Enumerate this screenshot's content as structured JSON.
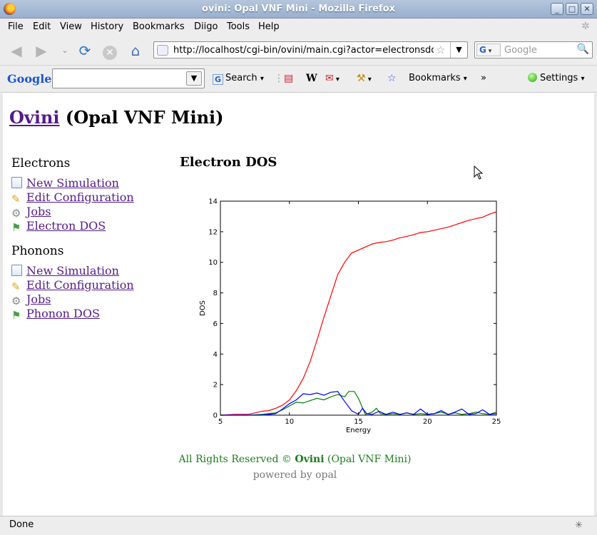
{
  "window": {
    "title": "ovini: Opal VNF Mini - Mozilla Firefox",
    "controls": [
      "_",
      "□",
      "✕"
    ]
  },
  "menu": [
    "File",
    "Edit",
    "View",
    "History",
    "Bookmarks",
    "Diigo",
    "Tools",
    "Help"
  ],
  "nav": {
    "url": "http://localhost/cgi-bin/ovini/main.cgi?actor=electronsdo",
    "search_engine_letter": "G",
    "search_placeholder": "Google"
  },
  "google_toolbar": {
    "logo": "Google",
    "search_label": "Search",
    "bookmarks_label": "Bookmarks",
    "more_label": "»",
    "settings_label": "Settings",
    "wiki_glyph": "W"
  },
  "page": {
    "brand_link": "Ovini",
    "brand_rest": " (Opal VNF Mini)",
    "sections": [
      {
        "heading": "Electrons",
        "links": [
          "New Simulation",
          "Edit Configuration",
          "Jobs",
          "Electron DOS"
        ]
      },
      {
        "heading": "Phonons",
        "links": [
          "New Simulation",
          "Edit Configuration",
          "Jobs",
          "Phonon DOS"
        ]
      }
    ],
    "main_heading": "Electron DOS",
    "footer_prefix": "All Rights Reserved © ",
    "footer_brand": "Ovini",
    "footer_suffix": " (Opal VNF Mini)",
    "powered_by": "powered by opal"
  },
  "status": {
    "text": "Done"
  },
  "colors": {
    "link": "#551a8b",
    "footer": "#1d7f1d",
    "series_red": "#ff0000",
    "series_green": "#008000",
    "series_blue": "#0000ff"
  },
  "chart_data": {
    "type": "line",
    "title": "",
    "xlabel": "Energy",
    "ylabel": "DOS",
    "xlim": [
      5,
      25
    ],
    "ylim": [
      0,
      14
    ],
    "xticks": [
      5,
      10,
      15,
      20,
      25
    ],
    "yticks": [
      0,
      2,
      4,
      6,
      8,
      10,
      12,
      14
    ],
    "grid": false,
    "legend": "none",
    "series": [
      {
        "color": "#ff0000",
        "x": [
          5,
          6,
          7,
          7.5,
          8,
          8.5,
          9,
          9.5,
          10,
          10.5,
          11,
          11.5,
          12,
          12.5,
          13,
          13.5,
          14,
          14.5,
          15,
          15.5,
          16,
          16.5,
          17,
          17.5,
          18,
          18.5,
          19,
          19.5,
          20,
          20.5,
          21,
          21.5,
          22,
          22.5,
          23,
          23.5,
          24,
          24.5,
          25
        ],
        "y": [
          0.0,
          0.05,
          0.05,
          0.15,
          0.25,
          0.3,
          0.45,
          0.65,
          1.0,
          1.6,
          2.4,
          3.5,
          4.9,
          6.4,
          7.8,
          9.2,
          10.0,
          10.6,
          10.8,
          11.0,
          11.2,
          11.3,
          11.35,
          11.45,
          11.6,
          11.7,
          11.8,
          11.95,
          12.0,
          12.1,
          12.2,
          12.3,
          12.45,
          12.6,
          12.75,
          12.85,
          12.95,
          13.15,
          13.3
        ]
      },
      {
        "color": "#008000",
        "x": [
          5,
          7,
          8,
          9,
          9.5,
          10,
          10.5,
          11,
          11.5,
          12,
          12.5,
          13,
          13.5,
          14,
          14.3,
          14.7,
          15,
          15.5,
          16,
          16.3,
          16.6,
          17,
          17.5,
          18,
          18.5,
          19,
          19.5,
          20,
          20.5,
          21,
          21.5,
          22,
          22.5,
          23,
          23.5,
          24,
          24.5,
          25
        ],
        "y": [
          0,
          0,
          0.05,
          0.15,
          0.35,
          0.6,
          0.85,
          0.8,
          0.95,
          1.1,
          1.0,
          1.2,
          1.35,
          1.2,
          1.55,
          1.55,
          1.1,
          0.05,
          0.2,
          0.45,
          0.1,
          0.05,
          0.1,
          0.05,
          0.15,
          0.05,
          0.1,
          0.05,
          0.1,
          0.2,
          0.05,
          0.15,
          0.05,
          0.1,
          0.2,
          0.1,
          0.05,
          0.2
        ]
      },
      {
        "color": "#0000ff",
        "x": [
          5,
          8,
          9,
          9.5,
          10,
          10.5,
          11,
          11.5,
          12,
          12.5,
          13,
          13.5,
          14,
          14.5,
          15,
          15.3,
          15.6,
          16,
          16.5,
          17,
          17.5,
          18,
          18.5,
          19,
          19.5,
          20,
          20.5,
          21,
          21.5,
          22,
          22.5,
          23,
          23.5,
          24,
          24.5,
          25
        ],
        "y": [
          0,
          0,
          0.1,
          0.4,
          0.75,
          1.0,
          1.4,
          1.35,
          1.45,
          1.3,
          1.5,
          1.55,
          0.9,
          0.3,
          0.05,
          0.45,
          0.1,
          0.05,
          0.25,
          0.05,
          0.2,
          0.05,
          0.15,
          0.05,
          0.4,
          0.05,
          0.1,
          0.3,
          0.05,
          0.2,
          0.4,
          0.05,
          0.1,
          0.35,
          0.05,
          0.1
        ]
      }
    ]
  }
}
